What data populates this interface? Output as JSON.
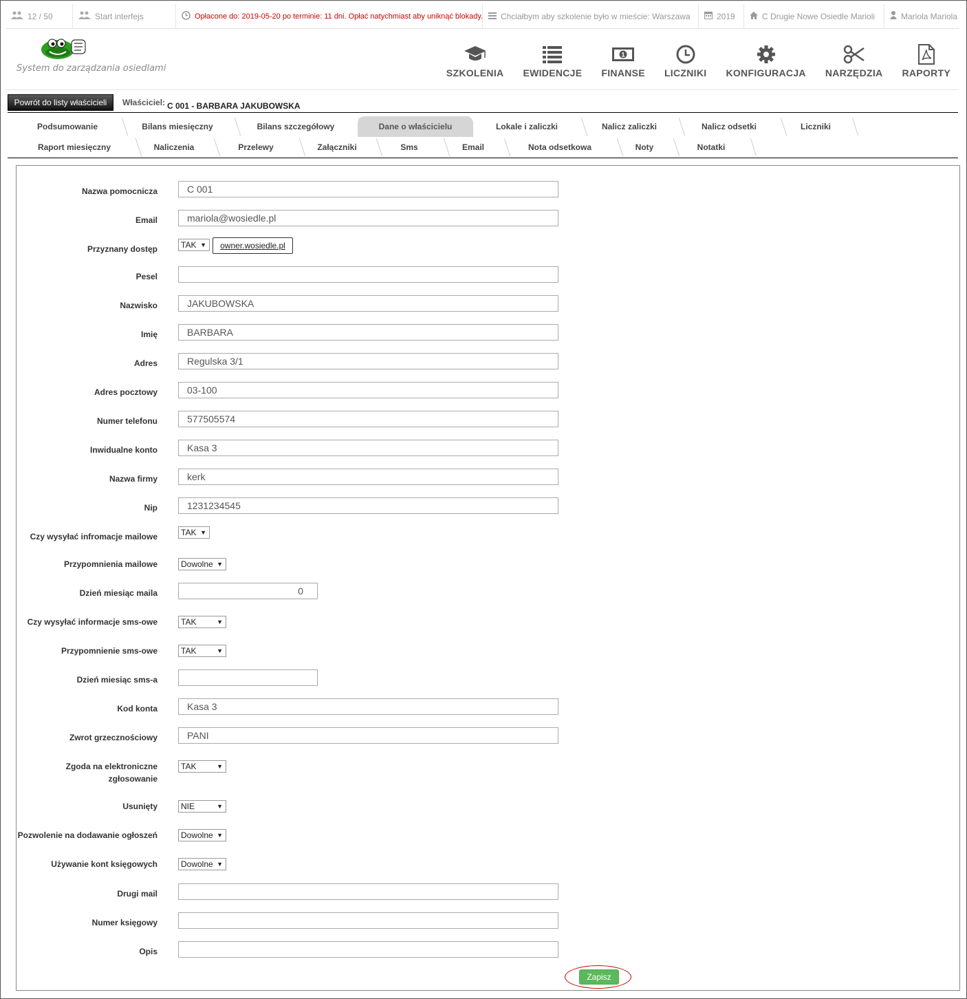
{
  "topbar": {
    "users_count": "12 / 50",
    "start_interface": "Start interfejs",
    "alert": "Opłacone do: 2019-05-20 po terminie: 11 dni. Opłać natychmiast aby uniknąć blokady.",
    "training_city": "Chciałbym aby szkolenie było w mieście: Warszawa",
    "year": "2019",
    "estate": "C Drugie Nowe Osiedle Marioli",
    "user": "Mariola Mariola"
  },
  "header": {
    "tagline": "System do zarządzania osiedlami",
    "nav": [
      {
        "label": "SZKOLENIA",
        "icon": "graduation-cap-icon"
      },
      {
        "label": "EWIDENCJE",
        "icon": "list-icon"
      },
      {
        "label": "FINANSE",
        "icon": "money-icon"
      },
      {
        "label": "LICZNIKI",
        "icon": "clock-icon"
      },
      {
        "label": "KONFIGURACJA",
        "icon": "gear-icon"
      },
      {
        "label": "NARZĘDZIA",
        "icon": "scissors-icon"
      },
      {
        "label": "RAPORTY",
        "icon": "pdf-icon"
      }
    ]
  },
  "owner": {
    "back_label": "Powrót do listy właścicieli",
    "owner_label": "Właściciel:",
    "owner_value": "C 001 - BARBARA JAKUBOWSKA"
  },
  "tabs": {
    "row1": [
      "Podsumowanie",
      "Bilans miesięczny",
      "Bilans szczegółowy",
      "Dane o właścicielu",
      "Lokale i zaliczki",
      "Nalicz zaliczki",
      "Nalicz odsetki",
      "Liczniki"
    ],
    "row2": [
      "Raport miesięczny",
      "Naliczenia",
      "Przelewy",
      "Załączniki",
      "Sms",
      "Email",
      "Nota odsetkowa",
      "Noty",
      "Notatki"
    ],
    "active": "Dane o właścicielu"
  },
  "form": {
    "nazwa_pomocnicza": {
      "label": "Nazwa pomocnicza",
      "value": "C 001"
    },
    "email": {
      "label": "Email",
      "value": "mariola@wosiedle.pl"
    },
    "dostep": {
      "label": "Przyznany dostęp",
      "value": "TAK",
      "link": "owner.wosiedle.pl"
    },
    "pesel": {
      "label": "Pesel",
      "value": ""
    },
    "nazwisko": {
      "label": "Nazwisko",
      "value": "JAKUBOWSKA"
    },
    "imie": {
      "label": "Imię",
      "value": "BARBARA"
    },
    "adres": {
      "label": "Adres",
      "value": "Regulska 3/1"
    },
    "adres_pocztowy": {
      "label": "Adres pocztowy",
      "value": "03-100"
    },
    "telefon": {
      "label": "Numer telefonu",
      "value": "577505574"
    },
    "konto": {
      "label": "Inwidualne konto",
      "value": "Kasa 3"
    },
    "firma": {
      "label": "Nazwa firmy",
      "value": "kerk"
    },
    "nip": {
      "label": "Nip",
      "value": "1231234545"
    },
    "wysylac_mail": {
      "label": "Czy wysyłać infromacje mailowe",
      "value": "TAK"
    },
    "przypomnienia_mail": {
      "label": "Przypomnienia mailowe",
      "value": "Dowolne"
    },
    "dzien_maila": {
      "label": "Dzień miesiąc maila",
      "value": "0"
    },
    "wysylac_sms": {
      "label": "Czy wysyłać informacje sms-owe",
      "value": "TAK"
    },
    "przypomnienie_sms": {
      "label": "Przypomnienie sms-owe",
      "value": "TAK"
    },
    "dzien_sms": {
      "label": "Dzień miesiąc sms-a",
      "value": ""
    },
    "kod_konta": {
      "label": "Kod konta",
      "value": "Kasa 3"
    },
    "zwrot": {
      "label": "Zwrot grzecznościowy",
      "value": "PANI"
    },
    "zgoda": {
      "label": "Zgoda na elektroniczne zgłosowanie",
      "value": "TAK"
    },
    "usuniety": {
      "label": "Usunięty",
      "value": "NIE"
    },
    "ogloszenia": {
      "label": "Pozwolenie na dodawanie ogłoszeń",
      "value": "Dowolne"
    },
    "konta_ksiegowe": {
      "label": "Używanie kont księgowych",
      "value": "Dowolne"
    },
    "drugi_mail": {
      "label": "Drugi mail",
      "value": ""
    },
    "numer_ksiegowy": {
      "label": "Numer księgowy",
      "value": ""
    },
    "opis": {
      "label": "Opis",
      "value": ""
    },
    "save_label": "Zapisz"
  },
  "colors": {
    "alert": "#d00000",
    "save": "#5cb85c",
    "logo_green": "#2e9e1f"
  }
}
